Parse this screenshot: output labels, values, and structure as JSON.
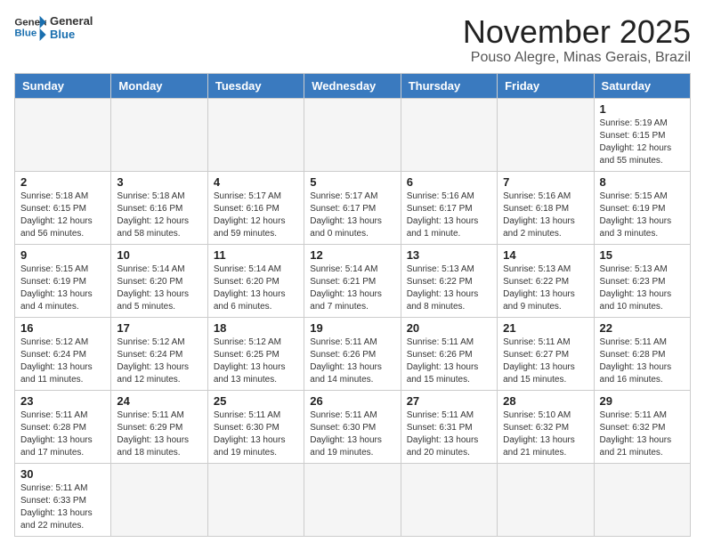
{
  "header": {
    "logo_general": "General",
    "logo_blue": "Blue",
    "month_title": "November 2025",
    "subtitle": "Pouso Alegre, Minas Gerais, Brazil"
  },
  "weekdays": [
    "Sunday",
    "Monday",
    "Tuesday",
    "Wednesday",
    "Thursday",
    "Friday",
    "Saturday"
  ],
  "days": [
    {
      "num": "",
      "sunrise": "",
      "sunset": "",
      "daylight": "",
      "empty": true
    },
    {
      "num": "",
      "sunrise": "",
      "sunset": "",
      "daylight": "",
      "empty": true
    },
    {
      "num": "",
      "sunrise": "",
      "sunset": "",
      "daylight": "",
      "empty": true
    },
    {
      "num": "",
      "sunrise": "",
      "sunset": "",
      "daylight": "",
      "empty": true
    },
    {
      "num": "",
      "sunrise": "",
      "sunset": "",
      "daylight": "",
      "empty": true
    },
    {
      "num": "",
      "sunrise": "",
      "sunset": "",
      "daylight": "",
      "empty": true
    },
    {
      "num": "1",
      "sunrise": "Sunrise: 5:19 AM",
      "sunset": "Sunset: 6:15 PM",
      "daylight": "Daylight: 12 hours and 55 minutes.",
      "empty": false
    },
    {
      "num": "2",
      "sunrise": "Sunrise: 5:18 AM",
      "sunset": "Sunset: 6:15 PM",
      "daylight": "Daylight: 12 hours and 56 minutes.",
      "empty": false
    },
    {
      "num": "3",
      "sunrise": "Sunrise: 5:18 AM",
      "sunset": "Sunset: 6:16 PM",
      "daylight": "Daylight: 12 hours and 58 minutes.",
      "empty": false
    },
    {
      "num": "4",
      "sunrise": "Sunrise: 5:17 AM",
      "sunset": "Sunset: 6:16 PM",
      "daylight": "Daylight: 12 hours and 59 minutes.",
      "empty": false
    },
    {
      "num": "5",
      "sunrise": "Sunrise: 5:17 AM",
      "sunset": "Sunset: 6:17 PM",
      "daylight": "Daylight: 13 hours and 0 minutes.",
      "empty": false
    },
    {
      "num": "6",
      "sunrise": "Sunrise: 5:16 AM",
      "sunset": "Sunset: 6:17 PM",
      "daylight": "Daylight: 13 hours and 1 minute.",
      "empty": false
    },
    {
      "num": "7",
      "sunrise": "Sunrise: 5:16 AM",
      "sunset": "Sunset: 6:18 PM",
      "daylight": "Daylight: 13 hours and 2 minutes.",
      "empty": false
    },
    {
      "num": "8",
      "sunrise": "Sunrise: 5:15 AM",
      "sunset": "Sunset: 6:19 PM",
      "daylight": "Daylight: 13 hours and 3 minutes.",
      "empty": false
    },
    {
      "num": "9",
      "sunrise": "Sunrise: 5:15 AM",
      "sunset": "Sunset: 6:19 PM",
      "daylight": "Daylight: 13 hours and 4 minutes.",
      "empty": false
    },
    {
      "num": "10",
      "sunrise": "Sunrise: 5:14 AM",
      "sunset": "Sunset: 6:20 PM",
      "daylight": "Daylight: 13 hours and 5 minutes.",
      "empty": false
    },
    {
      "num": "11",
      "sunrise": "Sunrise: 5:14 AM",
      "sunset": "Sunset: 6:20 PM",
      "daylight": "Daylight: 13 hours and 6 minutes.",
      "empty": false
    },
    {
      "num": "12",
      "sunrise": "Sunrise: 5:14 AM",
      "sunset": "Sunset: 6:21 PM",
      "daylight": "Daylight: 13 hours and 7 minutes.",
      "empty": false
    },
    {
      "num": "13",
      "sunrise": "Sunrise: 5:13 AM",
      "sunset": "Sunset: 6:22 PM",
      "daylight": "Daylight: 13 hours and 8 minutes.",
      "empty": false
    },
    {
      "num": "14",
      "sunrise": "Sunrise: 5:13 AM",
      "sunset": "Sunset: 6:22 PM",
      "daylight": "Daylight: 13 hours and 9 minutes.",
      "empty": false
    },
    {
      "num": "15",
      "sunrise": "Sunrise: 5:13 AM",
      "sunset": "Sunset: 6:23 PM",
      "daylight": "Daylight: 13 hours and 10 minutes.",
      "empty": false
    },
    {
      "num": "16",
      "sunrise": "Sunrise: 5:12 AM",
      "sunset": "Sunset: 6:24 PM",
      "daylight": "Daylight: 13 hours and 11 minutes.",
      "empty": false
    },
    {
      "num": "17",
      "sunrise": "Sunrise: 5:12 AM",
      "sunset": "Sunset: 6:24 PM",
      "daylight": "Daylight: 13 hours and 12 minutes.",
      "empty": false
    },
    {
      "num": "18",
      "sunrise": "Sunrise: 5:12 AM",
      "sunset": "Sunset: 6:25 PM",
      "daylight": "Daylight: 13 hours and 13 minutes.",
      "empty": false
    },
    {
      "num": "19",
      "sunrise": "Sunrise: 5:11 AM",
      "sunset": "Sunset: 6:26 PM",
      "daylight": "Daylight: 13 hours and 14 minutes.",
      "empty": false
    },
    {
      "num": "20",
      "sunrise": "Sunrise: 5:11 AM",
      "sunset": "Sunset: 6:26 PM",
      "daylight": "Daylight: 13 hours and 15 minutes.",
      "empty": false
    },
    {
      "num": "21",
      "sunrise": "Sunrise: 5:11 AM",
      "sunset": "Sunset: 6:27 PM",
      "daylight": "Daylight: 13 hours and 15 minutes.",
      "empty": false
    },
    {
      "num": "22",
      "sunrise": "Sunrise: 5:11 AM",
      "sunset": "Sunset: 6:28 PM",
      "daylight": "Daylight: 13 hours and 16 minutes.",
      "empty": false
    },
    {
      "num": "23",
      "sunrise": "Sunrise: 5:11 AM",
      "sunset": "Sunset: 6:28 PM",
      "daylight": "Daylight: 13 hours and 17 minutes.",
      "empty": false
    },
    {
      "num": "24",
      "sunrise": "Sunrise: 5:11 AM",
      "sunset": "Sunset: 6:29 PM",
      "daylight": "Daylight: 13 hours and 18 minutes.",
      "empty": false
    },
    {
      "num": "25",
      "sunrise": "Sunrise: 5:11 AM",
      "sunset": "Sunset: 6:30 PM",
      "daylight": "Daylight: 13 hours and 19 minutes.",
      "empty": false
    },
    {
      "num": "26",
      "sunrise": "Sunrise: 5:11 AM",
      "sunset": "Sunset: 6:30 PM",
      "daylight": "Daylight: 13 hours and 19 minutes.",
      "empty": false
    },
    {
      "num": "27",
      "sunrise": "Sunrise: 5:11 AM",
      "sunset": "Sunset: 6:31 PM",
      "daylight": "Daylight: 13 hours and 20 minutes.",
      "empty": false
    },
    {
      "num": "28",
      "sunrise": "Sunrise: 5:10 AM",
      "sunset": "Sunset: 6:32 PM",
      "daylight": "Daylight: 13 hours and 21 minutes.",
      "empty": false
    },
    {
      "num": "29",
      "sunrise": "Sunrise: 5:11 AM",
      "sunset": "Sunset: 6:32 PM",
      "daylight": "Daylight: 13 hours and 21 minutes.",
      "empty": false
    },
    {
      "num": "30",
      "sunrise": "Sunrise: 5:11 AM",
      "sunset": "Sunset: 6:33 PM",
      "daylight": "Daylight: 13 hours and 22 minutes.",
      "empty": false
    },
    {
      "num": "",
      "sunrise": "",
      "sunset": "",
      "daylight": "",
      "empty": true
    },
    {
      "num": "",
      "sunrise": "",
      "sunset": "",
      "daylight": "",
      "empty": true
    },
    {
      "num": "",
      "sunrise": "",
      "sunset": "",
      "daylight": "",
      "empty": true
    },
    {
      "num": "",
      "sunrise": "",
      "sunset": "",
      "daylight": "",
      "empty": true
    },
    {
      "num": "",
      "sunrise": "",
      "sunset": "",
      "daylight": "",
      "empty": true
    },
    {
      "num": "",
      "sunrise": "",
      "sunset": "",
      "daylight": "",
      "empty": true
    }
  ]
}
